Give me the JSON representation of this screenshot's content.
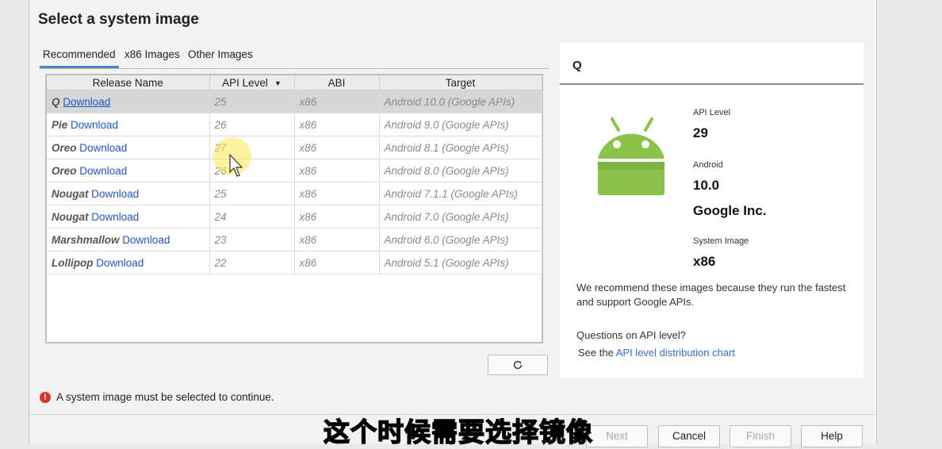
{
  "title": "Select a system image",
  "tabs": [
    {
      "label": "Recommended",
      "active": true
    },
    {
      "label": "x86 Images",
      "active": false
    },
    {
      "label": "Other Images",
      "active": false
    }
  ],
  "table": {
    "columns": [
      "Release Name",
      "API Level",
      "ABI",
      "Target"
    ],
    "sort_column": "API Level",
    "rows": [
      {
        "name": "Q",
        "action": "Download",
        "api": "25",
        "abi": "x86",
        "target": "Android 10.0 (Google APIs)",
        "selected": true
      },
      {
        "name": "Pie",
        "action": "Download",
        "api": "26",
        "abi": "x86",
        "target": "Android 9.0 (Google APIs)"
      },
      {
        "name": "Oreo",
        "action": "Download",
        "api": "27",
        "abi": "x86",
        "target": "Android 8.1 (Google APIs)"
      },
      {
        "name": "Oreo",
        "action": "Download",
        "api": "26",
        "abi": "x86",
        "target": "Android 8.0 (Google APIs)"
      },
      {
        "name": "Nougat",
        "action": "Download",
        "api": "25",
        "abi": "x86",
        "target": "Android 7.1.1 (Google APIs)"
      },
      {
        "name": "Nougat",
        "action": "Download",
        "api": "24",
        "abi": "x86",
        "target": "Android 7.0 (Google APIs)"
      },
      {
        "name": "Marshmallow",
        "action": "Download",
        "api": "23",
        "abi": "x86",
        "target": "Android 6.0 (Google APIs)"
      },
      {
        "name": "Lollipop",
        "action": "Download",
        "api": "22",
        "abi": "x86",
        "target": "Android 5.1 (Google APIs)"
      }
    ]
  },
  "refresh_icon": "refresh-icon",
  "details": {
    "title": "Q",
    "api_level_label": "API Level",
    "api_level": "29",
    "android_label": "Android",
    "android_version": "10.0",
    "vendor": "Google Inc.",
    "system_image_label": "System Image",
    "system_image": "x86",
    "recommend_text": "We recommend these images because they run the fastest and support Google APIs.",
    "question": "Questions on API level?",
    "see_prefix": "See the",
    "see_link": "API level distribution chart"
  },
  "error": "A system image must be selected to continue.",
  "buttons": {
    "next": "Next",
    "cancel": "Cancel",
    "finish": "Finish",
    "help": "Help"
  },
  "subtitle": "这个时候需要选择镜像",
  "colors": {
    "link": "#2255cc",
    "accent": "#4a84c6",
    "android_green": "#8bc34a",
    "error": "#d9342b"
  }
}
